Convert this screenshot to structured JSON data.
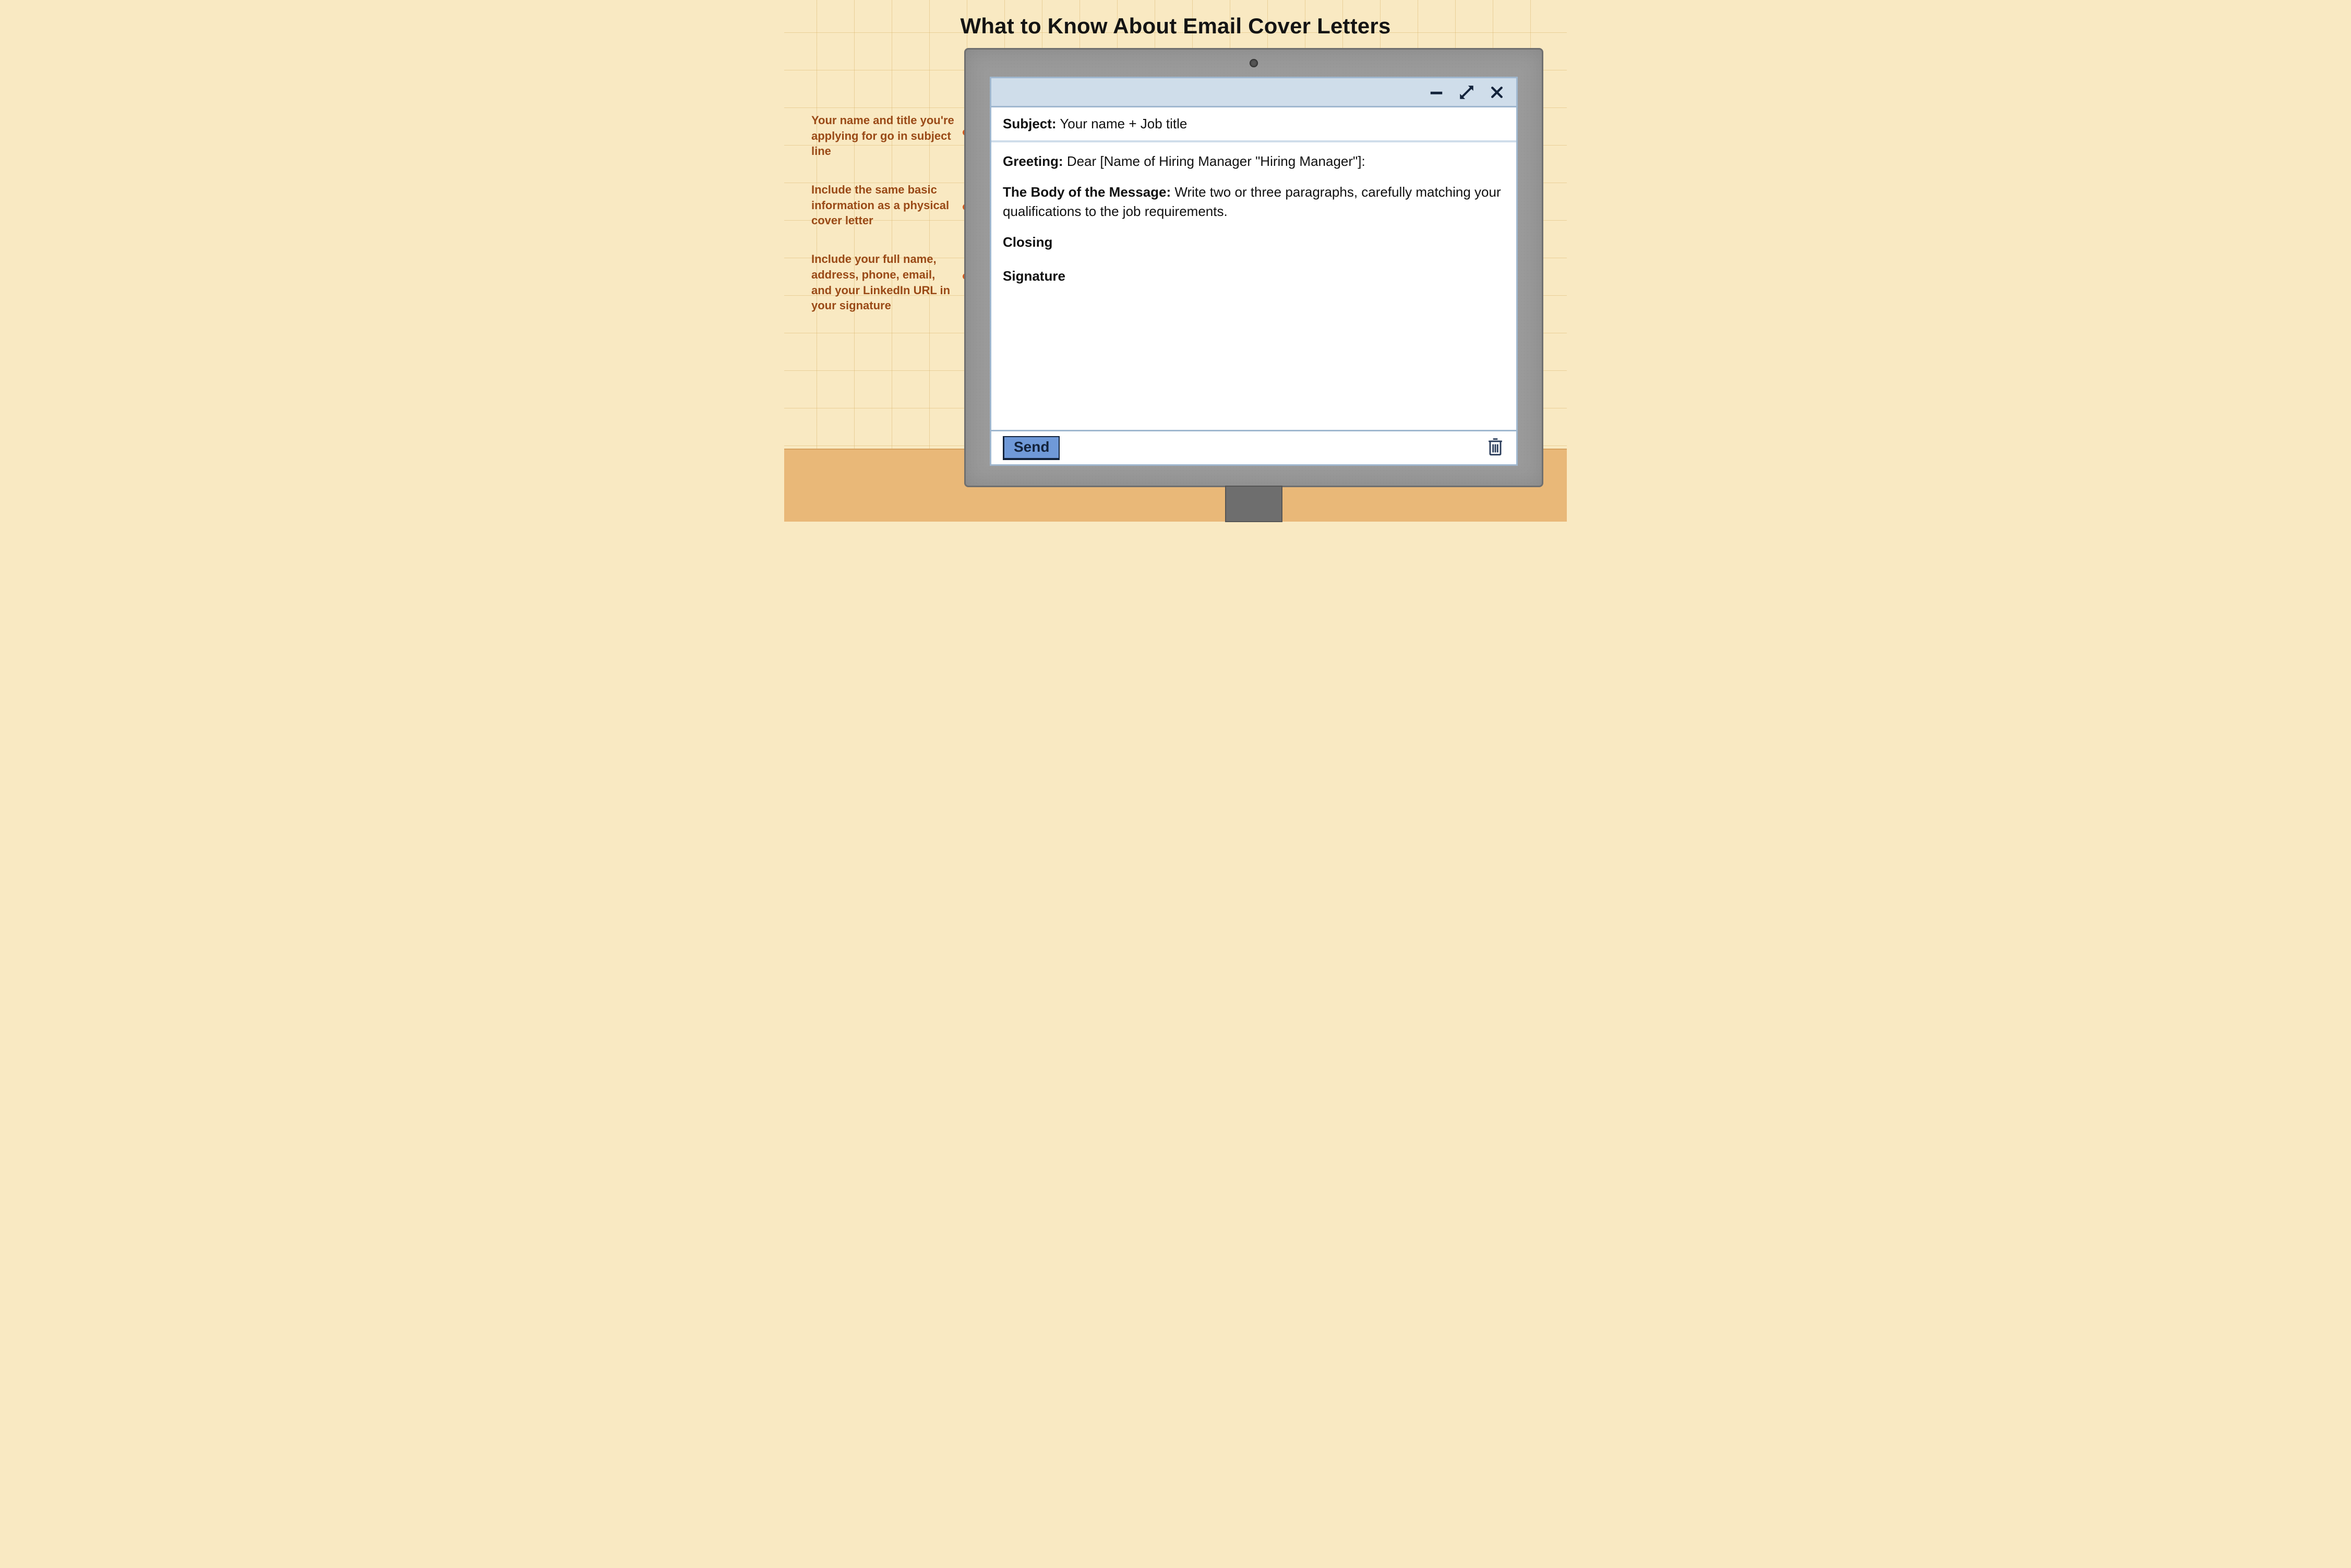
{
  "title": "What to Know About Email Cover Letters",
  "annotations": [
    "Your name and title you're applying for go in subject line",
    "Include the same basic information as a physical cover letter",
    "Include your full name, address, phone, email, and your LinkedIn URL in your signature"
  ],
  "email": {
    "subject_label": "Subject:",
    "subject_value": "Your name + Job title",
    "greeting_label": "Greeting:",
    "greeting_value": "Dear [Name of Hiring Manager \"Hiring Manager\"]:",
    "body_label": "The Body of the Message:",
    "body_value": "Write two or three paragraphs, carefully matching your qualifications to the job requirements.",
    "closing_label": "Closing",
    "signature_label": "Signature",
    "send_label": "Send"
  }
}
